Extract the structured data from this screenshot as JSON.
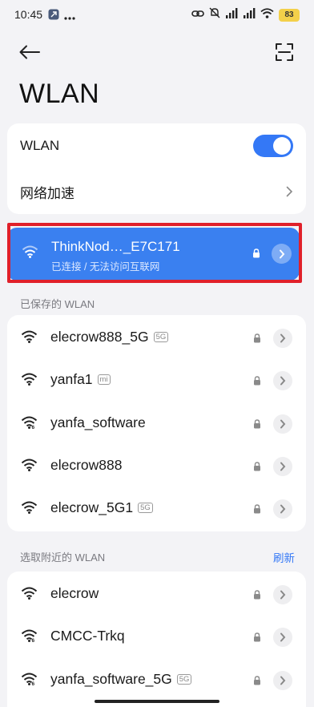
{
  "status_bar": {
    "time": "10:45",
    "battery": "83",
    "left_icons": [
      "app-notification-icon",
      "more-dots-icon"
    ],
    "right_icons": [
      "link-icon",
      "mute-icon",
      "signal-hd-icon",
      "signal-hd-icon",
      "wifi-icon"
    ]
  },
  "header": {
    "title": "WLAN",
    "back_icon": "arrow-left-icon",
    "scan_icon": "scan-icon"
  },
  "settings": {
    "wlan_label": "WLAN",
    "wlan_enabled": true,
    "accelerate_label": "网络加速"
  },
  "connected_network": {
    "name": "ThinkNod…_E7C171",
    "status": "已连接 / 无法访问互联网",
    "secured": true
  },
  "saved": {
    "title": "已保存的 WLAN",
    "networks": [
      {
        "name": "elecrow888_5G",
        "badge": "5G",
        "secured": true,
        "wifi6": false
      },
      {
        "name": "yanfa1",
        "badge": "mi",
        "secured": true,
        "wifi6": false
      },
      {
        "name": "yanfa_software",
        "badge": "",
        "secured": true,
        "wifi6": true
      },
      {
        "name": "elecrow888",
        "badge": "",
        "secured": true,
        "wifi6": false
      },
      {
        "name": "elecrow_5G1",
        "badge": "5G",
        "secured": true,
        "wifi6": false
      }
    ]
  },
  "nearby": {
    "title": "选取附近的 WLAN",
    "refresh_label": "刷新",
    "networks": [
      {
        "name": "elecrow",
        "badge": "",
        "secured": true,
        "wifi6": false
      },
      {
        "name": "CMCC-Trkq",
        "badge": "",
        "secured": true,
        "wifi6": true
      },
      {
        "name": "yanfa_software_5G",
        "badge": "5G",
        "secured": true,
        "wifi6": true
      }
    ]
  },
  "colors": {
    "accent": "#3478f6",
    "connected_bg": "#3a80f0",
    "highlight_frame": "#e0202a",
    "background": "#f3f3f6"
  }
}
